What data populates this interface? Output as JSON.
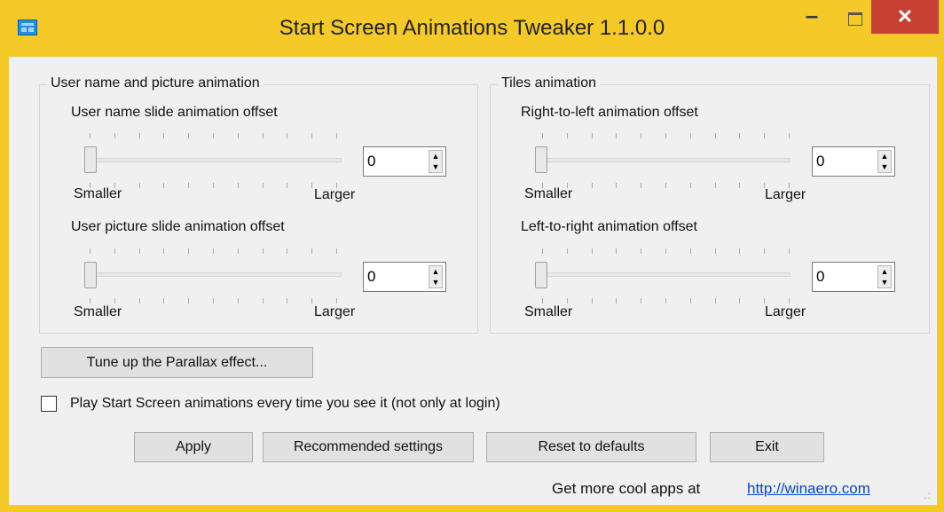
{
  "window": {
    "title": "Start Screen Animations Tweaker 1.1.0.0",
    "minimize": "–",
    "close": "✕"
  },
  "user_group": {
    "legend": "User name and picture animation",
    "sliders": [
      {
        "label": "User name slide animation offset",
        "value": "0",
        "min_label": "Smaller",
        "max_label": "Larger",
        "position": 0
      },
      {
        "label": "User picture slide animation offset",
        "value": "0",
        "min_label": "Smaller",
        "max_label": "Larger",
        "position": 0
      }
    ]
  },
  "tiles_group": {
    "legend": "Tiles animation",
    "sliders": [
      {
        "label": "Right-to-left animation offset",
        "value": "0",
        "min_label": "Smaller",
        "max_label": "Larger",
        "position": 0
      },
      {
        "label": "Left-to-right animation offset",
        "value": "0",
        "min_label": "Smaller",
        "max_label": "Larger",
        "position": 0
      }
    ]
  },
  "parallax_button": "Tune up the Parallax effect...",
  "play_checkbox": {
    "label": "Play Start Screen animations every time you see it (not only at login)",
    "checked": false
  },
  "buttons": {
    "apply": "Apply",
    "recommended": "Recommended settings",
    "reset": "Reset to defaults",
    "exit": "Exit"
  },
  "footer": {
    "text": "Get more cool apps at",
    "link": "http://winaero.com"
  }
}
